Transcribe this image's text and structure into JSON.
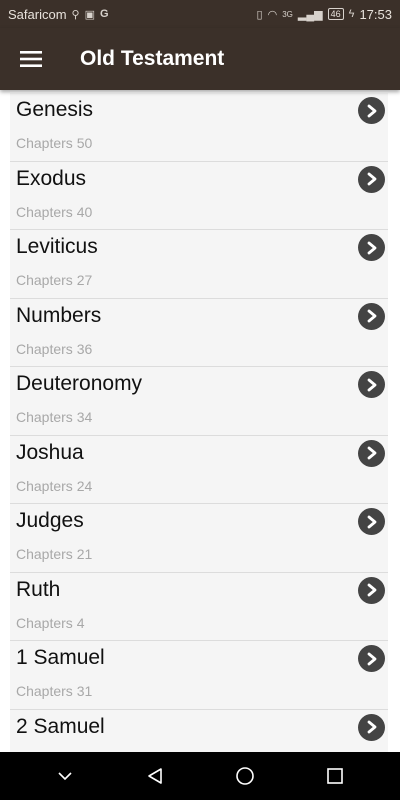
{
  "status_bar": {
    "carrier": "Safaricom",
    "network": "3G",
    "battery": "46",
    "time": "17:53"
  },
  "app_bar": {
    "title": "Old Testament"
  },
  "books": [
    {
      "name": "Genesis",
      "chapters": "Chapters 50"
    },
    {
      "name": "Exodus",
      "chapters": "Chapters 40"
    },
    {
      "name": "Leviticus",
      "chapters": "Chapters 27"
    },
    {
      "name": "Numbers",
      "chapters": "Chapters 36"
    },
    {
      "name": "Deuteronomy",
      "chapters": "Chapters 34"
    },
    {
      "name": "Joshua",
      "chapters": "Chapters 24"
    },
    {
      "name": "Judges",
      "chapters": "Chapters 21"
    },
    {
      "name": "Ruth",
      "chapters": "Chapters 4"
    },
    {
      "name": "1 Samuel",
      "chapters": "Chapters 31"
    },
    {
      "name": "2 Samuel",
      "chapters": ""
    }
  ],
  "icons": {
    "menu": "hamburger-menu-icon",
    "row": "chevron-right-icon",
    "nav": [
      "collapse-icon",
      "back-icon",
      "home-icon",
      "recents-icon"
    ]
  },
  "colors": {
    "app_bar": "#3b3029",
    "row_background": "#f5f5f5",
    "chevron": "#444444"
  }
}
